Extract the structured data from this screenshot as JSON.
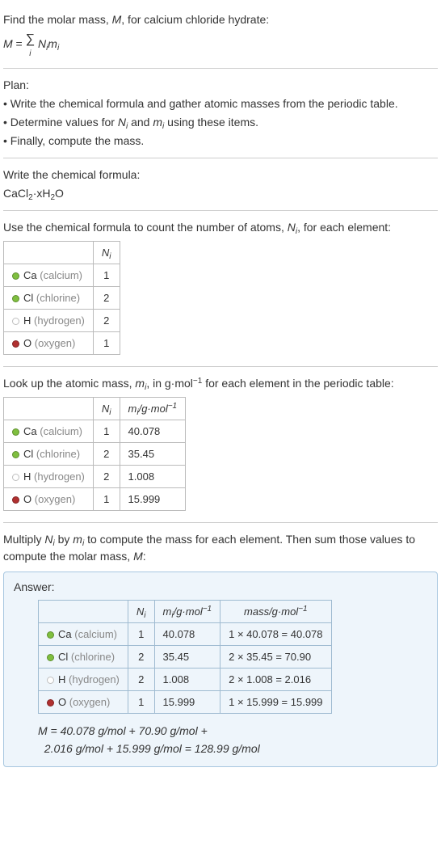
{
  "intro": {
    "find_line": "Find the molar mass, M, for calcium chloride hydrate:",
    "formula": "M = ∑ Nᵢmᵢ",
    "sigma_under": "i"
  },
  "plan": {
    "heading": "Plan:",
    "b1": "• Write the chemical formula and gather atomic masses from the periodic table.",
    "b2": "• Determine values for Nᵢ and mᵢ using these items.",
    "b3": "• Finally, compute the mass."
  },
  "write": {
    "heading": "Write the chemical formula:",
    "formula": "CaCl₂·xH₂O"
  },
  "count": {
    "heading": "Use the chemical formula to count the number of atoms, Nᵢ, for each element:",
    "col_n": "Nᵢ",
    "rows": [
      {
        "color": "#7fbf3f",
        "sym": "Ca",
        "name": "(calcium)",
        "n": "1"
      },
      {
        "color": "#7fbf3f",
        "sym": "Cl",
        "name": "(chlorine)",
        "n": "2"
      },
      {
        "color": "#ffffff",
        "sym": "H",
        "name": "(hydrogen)",
        "n": "2"
      },
      {
        "color": "#b03030",
        "sym": "O",
        "name": "(oxygen)",
        "n": "1"
      }
    ]
  },
  "lookup": {
    "heading": "Look up the atomic mass, mᵢ, in g·mol⁻¹ for each element in the periodic table:",
    "col_n": "Nᵢ",
    "col_m": "mᵢ/g·mol⁻¹",
    "rows": [
      {
        "color": "#7fbf3f",
        "sym": "Ca",
        "name": "(calcium)",
        "n": "1",
        "m": "40.078"
      },
      {
        "color": "#7fbf3f",
        "sym": "Cl",
        "name": "(chlorine)",
        "n": "2",
        "m": "35.45"
      },
      {
        "color": "#ffffff",
        "sym": "H",
        "name": "(hydrogen)",
        "n": "2",
        "m": "1.008"
      },
      {
        "color": "#b03030",
        "sym": "O",
        "name": "(oxygen)",
        "n": "1",
        "m": "15.999"
      }
    ]
  },
  "multiply": {
    "heading": "Multiply Nᵢ by mᵢ to compute the mass for each element. Then sum those values to compute the molar mass, M:"
  },
  "answer": {
    "label": "Answer:",
    "col_n": "Nᵢ",
    "col_m": "mᵢ/g·mol⁻¹",
    "col_mass": "mass/g·mol⁻¹",
    "rows": [
      {
        "color": "#7fbf3f",
        "sym": "Ca",
        "name": "(calcium)",
        "n": "1",
        "m": "40.078",
        "mass": "1 × 40.078 = 40.078"
      },
      {
        "color": "#7fbf3f",
        "sym": "Cl",
        "name": "(chlorine)",
        "n": "2",
        "m": "35.45",
        "mass": "2 × 35.45 = 70.90"
      },
      {
        "color": "#ffffff",
        "sym": "H",
        "name": "(hydrogen)",
        "n": "2",
        "m": "1.008",
        "mass": "2 × 1.008 = 2.016"
      },
      {
        "color": "#b03030",
        "sym": "O",
        "name": "(oxygen)",
        "n": "1",
        "m": "15.999",
        "mass": "1 × 15.999 = 15.999"
      }
    ],
    "final1": "M = 40.078 g/mol + 70.90 g/mol +",
    "final2": "2.016 g/mol + 15.999 g/mol = 128.99 g/mol"
  }
}
